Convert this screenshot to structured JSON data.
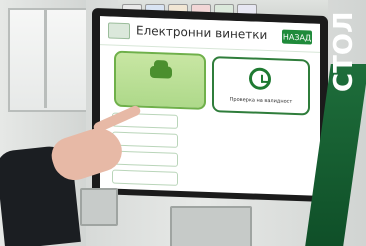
{
  "screen": {
    "title": "Електронни винетки",
    "back_label": "НАЗАД",
    "tiles": [
      {
        "label": "",
        "icon": "car-icon"
      },
      {
        "label": "Проверка на валидност",
        "icon": "clock-icon"
      }
    ],
    "menu_items": [
      "",
      "",
      "",
      ""
    ]
  },
  "kiosk": {
    "side_text": "СТОЛ"
  }
}
